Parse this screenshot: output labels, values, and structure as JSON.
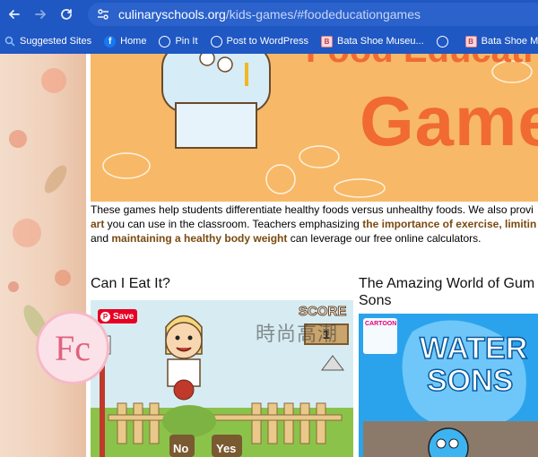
{
  "browser": {
    "url_domain": "culinaryschools.org",
    "url_path": "/kids-games/#foodeducationgames"
  },
  "bookmarks": [
    {
      "label": "Suggested Sites",
      "icon": "search-icon"
    },
    {
      "label": "Home",
      "icon": "facebook-icon"
    },
    {
      "label": "Pin It",
      "icon": "globe-icon"
    },
    {
      "label": "Post to WordPress",
      "icon": "globe-icon"
    },
    {
      "label": "Bata Shoe Museu...",
      "icon": "bata-icon"
    },
    {
      "label": "",
      "icon": "globe-icon"
    },
    {
      "label": "Bata Shoe M",
      "icon": "bata-icon"
    }
  ],
  "banner": {
    "title": "Game",
    "title_top": "Food Educati"
  },
  "intro": {
    "line1": "These games help students differentiate healthy foods versus unhealthy foods. We also provi",
    "line2_link": "art",
    "line2_text": " you can use in the classroom. Teachers emphasizing ",
    "line2_link2": "the importance of exercise",
    "line2_link3": ", limitin",
    "line3_text": "and ",
    "line3_link": "maintaining a healthy body weight",
    "line3_text2": " can leverage our free online calculators."
  },
  "cards": [
    {
      "title": "Can I Eat It?"
    },
    {
      "title": "The Amazing World of Gum",
      "title2": "Sons"
    }
  ],
  "game1": {
    "save_label": "Save",
    "score_label": "SCORE",
    "score_value": "1",
    "no_label": "No",
    "yes_label": "Yes"
  },
  "game2": {
    "logo_top": "CARTOON",
    "title_line1": "WATER",
    "title_line2": "SONS"
  },
  "watermark": {
    "text": "時尚高潮",
    "logo": "Fc"
  },
  "colors": {
    "chrome": "#1f57c3",
    "banner": "#f7b967",
    "banner_text": "#f06a32",
    "link": "#7a4a10"
  }
}
